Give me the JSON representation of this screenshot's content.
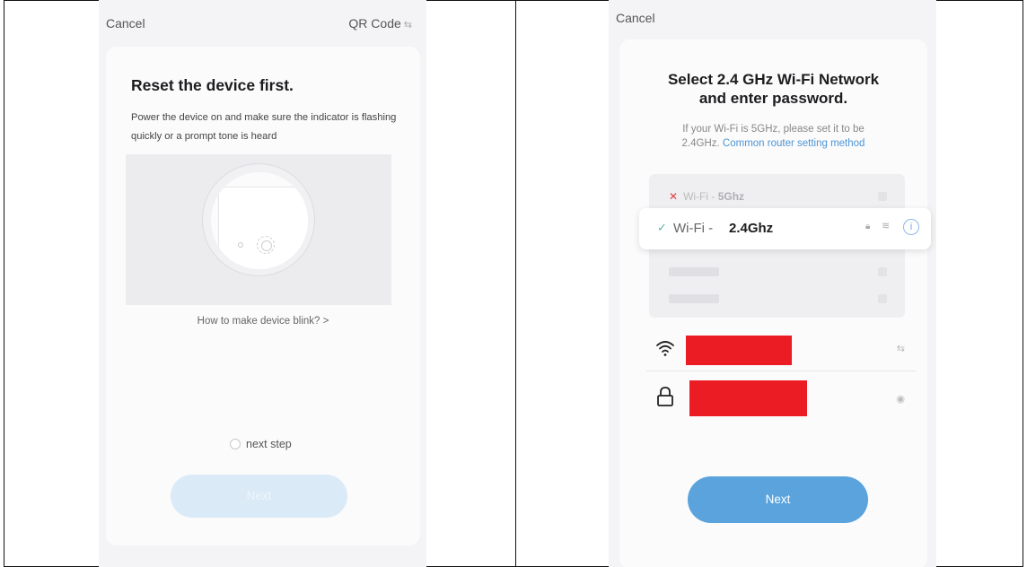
{
  "left": {
    "cancel_label": "Cancel",
    "qr_label": "QR Code",
    "qr_icon": "⇆",
    "title": "Reset the device first.",
    "description": "Power the device on and make sure the indicator is flashing quickly or a prompt tone is heard",
    "blink_link": "How to make device blink? >",
    "next_step_label": "next step",
    "next_step_checked": false,
    "next_button": "Next",
    "next_button_enabled": false
  },
  "right": {
    "cancel_label": "Cancel",
    "title_line1": "Select 2.4 GHz Wi-Fi Network",
    "title_line2": "and enter password.",
    "desc_line1": "If your Wi-Fi is 5GHz, please set it to be",
    "desc_line2_prefix": "2.4GHz.",
    "desc_link": "Common router setting method",
    "wifi_5g_prefix": "Wi-Fi - ",
    "wifi_5g_band": "5Ghz",
    "wifi_24_prefix": "Wi-Fi - ",
    "wifi_24_band": "2.4Ghz",
    "ssid_trailing_icon": "⇆",
    "password_trailing_icon": "◉",
    "next_button": "Next",
    "colors": {
      "accent": "#5aa3dd",
      "link": "#4c95d4",
      "error_x": "#e04040",
      "check": "#5ab8a8",
      "redaction": "#ec1c24"
    }
  }
}
